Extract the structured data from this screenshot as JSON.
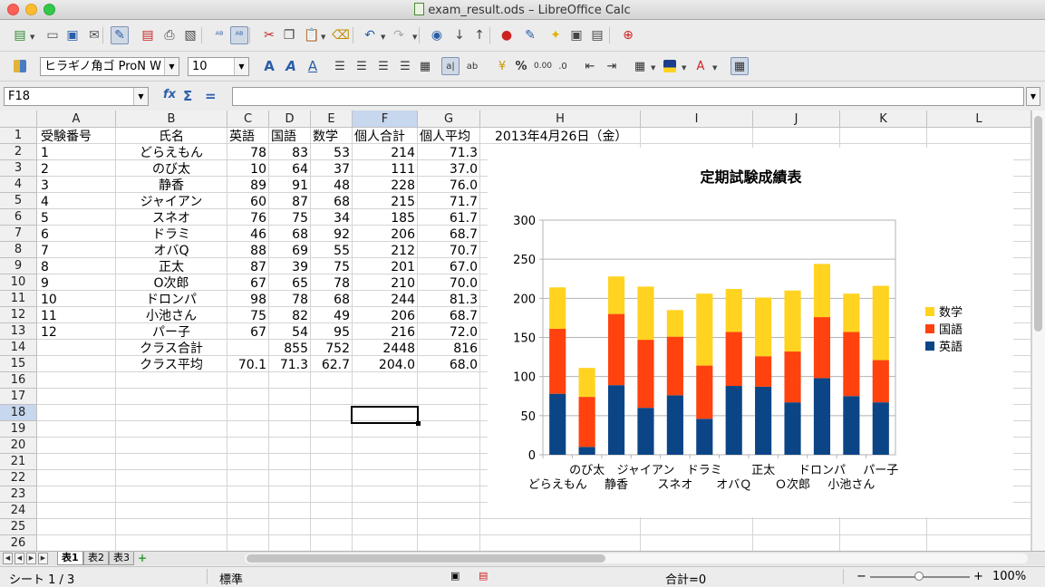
{
  "window": {
    "title": "exam_result.ods – LibreOffice Calc"
  },
  "toolbar1": {
    "icons": [
      "new-document-icon",
      "open-folder-icon",
      "save-icon",
      "email-icon",
      "edit-mode-icon",
      "export-pdf-icon",
      "print-icon",
      "print-preview-icon",
      "spellcheck-icon",
      "autospellcheck-icon",
      "cut-icon",
      "copy-icon",
      "paste-icon",
      "clone-formatting-icon",
      "undo-icon",
      "redo-icon",
      "navigator-icon",
      "sort-ascending-icon",
      "sort-descending-icon",
      "insert-chart-icon",
      "draw-functions-icon",
      "gallery-icon",
      "insert-image-icon",
      "datasource-icon",
      "help-icon"
    ]
  },
  "toolbar2": {
    "font_name": "ヒラギノ角ゴ ProN W",
    "font_size": "10",
    "percent_label": "%",
    "decimal_label": "0.00"
  },
  "formula_bar": {
    "cell_ref": "F18",
    "function_wizard": "fx",
    "sum": "Σ",
    "equals": "=",
    "formula": ""
  },
  "columns": [
    "A",
    "B",
    "C",
    "D",
    "E",
    "F",
    "G",
    "H",
    "I",
    "J",
    "K",
    "L"
  ],
  "selected_column": "F",
  "selected_row": "18",
  "rows": [
    "1",
    "2",
    "3",
    "4",
    "5",
    "6",
    "7",
    "8",
    "9",
    "10",
    "11",
    "12",
    "13",
    "14",
    "15",
    "16",
    "17",
    "18",
    "19",
    "20",
    "21",
    "22",
    "23",
    "24",
    "25",
    "26"
  ],
  "sheet": {
    "header": [
      "受験番号",
      "氏名",
      "英語",
      "国語",
      "数学",
      "個人合計",
      "個人平均"
    ],
    "date": "2013年4月26日（金）",
    "records": [
      [
        "1",
        "どらえもん",
        "78",
        "83",
        "53",
        "214",
        "71.3"
      ],
      [
        "2",
        "のび太",
        "10",
        "64",
        "37",
        "111",
        "37.0"
      ],
      [
        "3",
        "静香",
        "89",
        "91",
        "48",
        "228",
        "76.0"
      ],
      [
        "4",
        "ジャイアン",
        "60",
        "87",
        "68",
        "215",
        "71.7"
      ],
      [
        "5",
        "スネオ",
        "76",
        "75",
        "34",
        "185",
        "61.7"
      ],
      [
        "6",
        "ドラミ",
        "46",
        "68",
        "92",
        "206",
        "68.7"
      ],
      [
        "7",
        "オバQ",
        "88",
        "69",
        "55",
        "212",
        "70.7"
      ],
      [
        "8",
        "正太",
        "87",
        "39",
        "75",
        "201",
        "67.0"
      ],
      [
        "9",
        "O次郎",
        "67",
        "65",
        "78",
        "210",
        "70.0"
      ],
      [
        "10",
        "ドロンパ",
        "98",
        "78",
        "68",
        "244",
        "81.3"
      ],
      [
        "11",
        "小池さん",
        "75",
        "82",
        "49",
        "206",
        "68.7"
      ],
      [
        "12",
        "パー子",
        "67",
        "54",
        "95",
        "216",
        "72.0"
      ]
    ],
    "total_row": [
      "",
      "クラス合計",
      "",
      "855",
      "752",
      "2448",
      "816"
    ],
    "avg_row": [
      "",
      "クラス平均",
      "70.1",
      "71.3",
      "62.7",
      "204.0",
      "68.0"
    ]
  },
  "chart_data": {
    "type": "bar",
    "stacked": true,
    "title": "定期試験成績表",
    "categories": [
      "どらえもん",
      "のび太",
      "静香",
      "ジャイアン",
      "スネオ",
      "ドラミ",
      "オバＱ",
      "正太",
      "Ｏ次郎",
      "ドロンパ",
      "小池さん",
      "パー子"
    ],
    "series": [
      {
        "name": "英語",
        "color": "#0b4586",
        "values": [
          78,
          10,
          89,
          60,
          76,
          46,
          88,
          87,
          67,
          98,
          75,
          67
        ]
      },
      {
        "name": "国語",
        "color": "#ff420e",
        "values": [
          83,
          64,
          91,
          87,
          75,
          68,
          69,
          39,
          65,
          78,
          82,
          54
        ]
      },
      {
        "name": "数学",
        "color": "#ffd320",
        "values": [
          53,
          37,
          48,
          68,
          34,
          92,
          55,
          75,
          78,
          68,
          49,
          95
        ]
      }
    ],
    "legend": [
      "数学",
      "国語",
      "英語"
    ],
    "legend_position": "right",
    "yticks": [
      "0",
      "50",
      "100",
      "150",
      "200",
      "250",
      "300"
    ],
    "ylim": [
      0,
      300
    ],
    "grid": true
  },
  "tabs": {
    "sheets": [
      "表1",
      "表2",
      "表3"
    ],
    "active": "表1",
    "add": "+"
  },
  "status": {
    "sheet": "シート 1 / 3",
    "style": "標準",
    "sum": "合計=0",
    "zoom": "100%",
    "zoom_minus": "−",
    "zoom_plus": "+"
  }
}
